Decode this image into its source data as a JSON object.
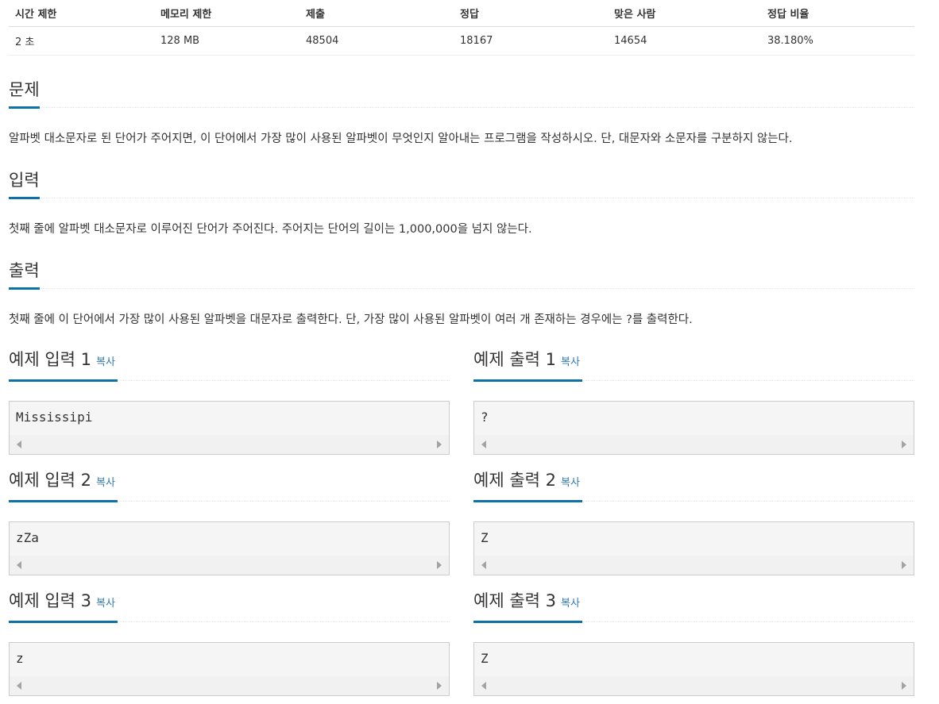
{
  "stats": {
    "headers": [
      "시간 제한",
      "메모리 제한",
      "제출",
      "정답",
      "맞은 사람",
      "정답 비율"
    ],
    "values": [
      "2 초",
      "128 MB",
      "48504",
      "18167",
      "14654",
      "38.180%"
    ]
  },
  "problem": {
    "title": "문제",
    "text": "알파벳 대소문자로 된 단어가 주어지면, 이 단어에서 가장 많이 사용된 알파벳이 무엇인지 알아내는 프로그램을 작성하시오. 단, 대문자와 소문자를 구분하지 않는다."
  },
  "input": {
    "title": "입력",
    "text": "첫째 줄에 알파벳 대소문자로 이루어진 단어가 주어진다. 주어지는 단어의 길이는 1,000,000을 넘지 않는다."
  },
  "output": {
    "title": "출력",
    "text": "첫째 줄에 이 단어에서 가장 많이 사용된 알파벳을 대문자로 출력한다. 단, 가장 많이 사용된 알파벳이 여러 개 존재하는 경우에는 ?를 출력한다."
  },
  "copy_label": "복사",
  "examples": [
    {
      "input_title": "예제 입력 1",
      "input": "Mississipi",
      "output_title": "예제 출력 1",
      "output": "?"
    },
    {
      "input_title": "예제 입력 2",
      "input": "zZa",
      "output_title": "예제 출력 2",
      "output": "Z"
    },
    {
      "input_title": "예제 입력 3",
      "input": "z",
      "output_title": "예제 출력 3",
      "output": "Z"
    }
  ],
  "colors": {
    "accent": "#0d72a8",
    "link": "#2f7ab8",
    "pre_bg": "#f5f5f5"
  }
}
